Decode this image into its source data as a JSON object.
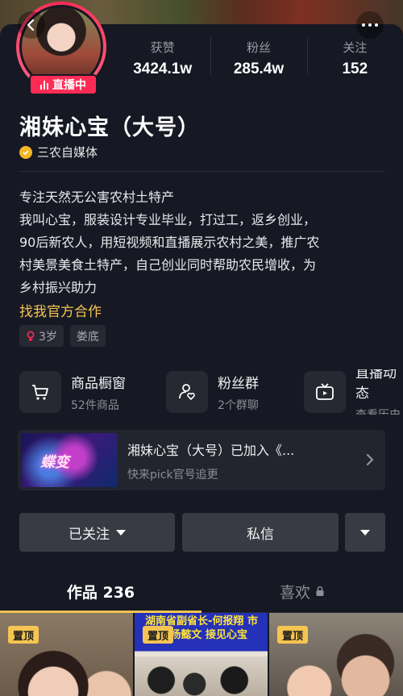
{
  "header": {
    "back_icon": "chevron-left-icon",
    "more_icon": "more-dots-icon"
  },
  "profile": {
    "live_badge": "直播中",
    "name": "湘妹心宝（大号）",
    "verify_label": "三农自媒体",
    "verify_color": "#f5b527",
    "bio_lines": [
      "专注天然无公害农村土特产",
      "我叫心宝，服装设计专业毕业，打过工，返乡创业，",
      "90后新农人，用短视频和直播展示农村之美，推广农",
      "村美景美食土特产，自己创业同时帮助农民增收，为",
      "乡村振兴助力"
    ],
    "partner_link": "找我官方合作",
    "tags": [
      {
        "icon": "female-icon",
        "label": "3岁"
      },
      {
        "icon": "",
        "label": "娄底"
      }
    ]
  },
  "stats": [
    {
      "label": "获赞",
      "value": "3424.1w"
    },
    {
      "label": "粉丝",
      "value": "285.4w"
    },
    {
      "label": "关注",
      "value": "152"
    }
  ],
  "features": [
    {
      "icon": "cart-icon",
      "title": "商品橱窗",
      "sub": "52件商品"
    },
    {
      "icon": "fan-group-icon",
      "title": "粉丝群",
      "sub": "2个群聊"
    },
    {
      "icon": "tv-icon",
      "title": "直播动态",
      "sub": "查看历史"
    }
  ],
  "promo": {
    "thumb_text": "蝶变",
    "title": "湘妹心宝（大号）已加入《...",
    "sub": "快来pick官号追更"
  },
  "actions": {
    "follow": "已关注",
    "message": "私信"
  },
  "tabs": [
    {
      "label": "作品 236",
      "active": true
    },
    {
      "label": "喜欢",
      "active": false,
      "lock": true
    }
  ],
  "videos": [
    {
      "pin": "置顶",
      "caption": ""
    },
    {
      "pin": "置顶",
      "caption": "湖南省副省长-何报翔 市长-杨懿文 接见心宝"
    },
    {
      "pin": "置顶",
      "caption": ""
    }
  ],
  "colors": {
    "live": "#fe2c55",
    "accent": "#f5c452",
    "bg": "#161823"
  }
}
